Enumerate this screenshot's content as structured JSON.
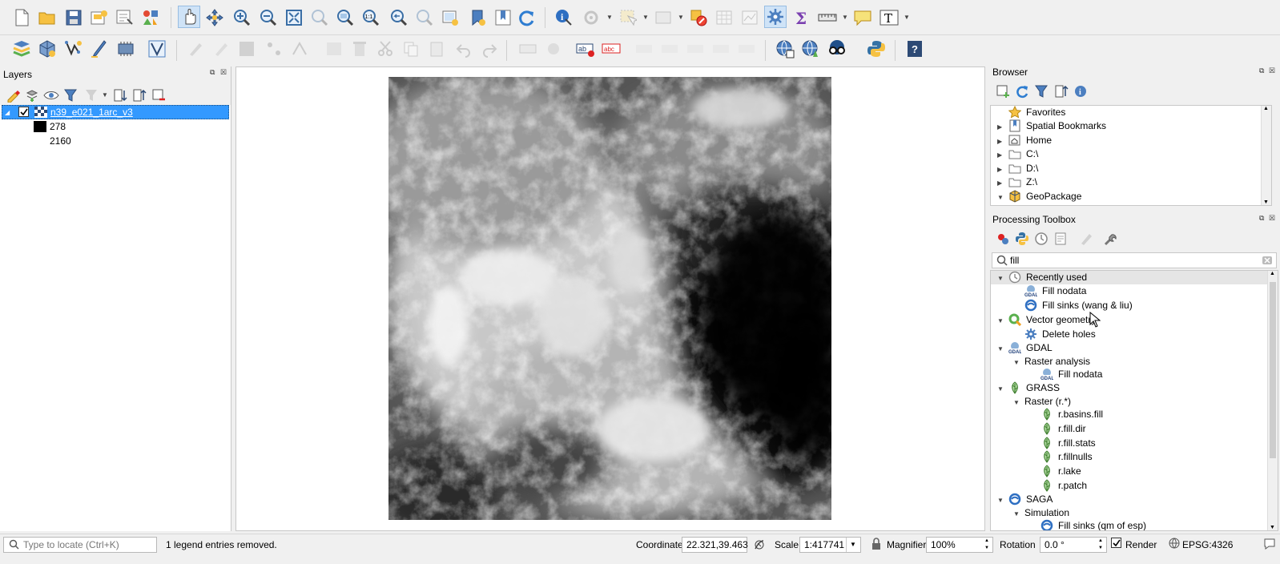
{
  "layers_panel": {
    "title": "Layers",
    "layer": {
      "name": "n39_e021_1arc_v3",
      "checked": true
    },
    "legend": [
      {
        "label": "278",
        "swatch_color": "#000000"
      },
      {
        "label": "2160",
        "swatch_color": "#ffffff"
      }
    ]
  },
  "browser_panel": {
    "title": "Browser",
    "items": [
      {
        "label": "Favorites",
        "icon": "star-icon",
        "expand": "none"
      },
      {
        "label": "Spatial Bookmarks",
        "icon": "bookmark-icon",
        "expand": "collapsed"
      },
      {
        "label": "Home",
        "icon": "home-folder-icon",
        "expand": "collapsed"
      },
      {
        "label": "C:\\",
        "icon": "folder-icon",
        "expand": "collapsed"
      },
      {
        "label": "D:\\",
        "icon": "folder-icon",
        "expand": "collapsed"
      },
      {
        "label": "Z:\\",
        "icon": "folder-icon",
        "expand": "collapsed"
      },
      {
        "label": "GeoPackage",
        "icon": "geopackage-icon",
        "expand": "expanded"
      }
    ]
  },
  "processing_toolbox": {
    "title": "Processing Toolbox",
    "search_value": "fill",
    "tree": [
      {
        "label": "Recently used",
        "icon": "clock-icon",
        "level": 0,
        "expand": "expanded"
      },
      {
        "label": "Fill nodata",
        "icon": "gdal-icon",
        "level": 2
      },
      {
        "label": "Fill sinks (wang & liu)",
        "icon": "saga-icon",
        "level": 2
      },
      {
        "label": "Vector geometry",
        "icon": "qgis-icon",
        "level": 0,
        "expand": "expanded"
      },
      {
        "label": "Delete holes",
        "icon": "gear-icon",
        "level": 2
      },
      {
        "label": "GDAL",
        "icon": "gdal-icon",
        "level": 0,
        "expand": "expanded"
      },
      {
        "label": "Raster analysis",
        "icon": "",
        "level": 1,
        "expand": "expanded"
      },
      {
        "label": "Fill nodata",
        "icon": "gdal-icon",
        "level": 3
      },
      {
        "label": "GRASS",
        "icon": "grass-icon",
        "level": 0,
        "expand": "expanded"
      },
      {
        "label": "Raster (r.*)",
        "icon": "",
        "level": 1,
        "expand": "expanded"
      },
      {
        "label": "r.basins.fill",
        "icon": "grass-icon",
        "level": 3
      },
      {
        "label": "r.fill.dir",
        "icon": "grass-icon",
        "level": 3
      },
      {
        "label": "r.fill.stats",
        "icon": "grass-icon",
        "level": 3
      },
      {
        "label": "r.fillnulls",
        "icon": "grass-icon",
        "level": 3
      },
      {
        "label": "r.lake",
        "icon": "grass-icon",
        "level": 3
      },
      {
        "label": "r.patch",
        "icon": "grass-icon",
        "level": 3
      },
      {
        "label": "SAGA",
        "icon": "saga-icon",
        "level": 0,
        "expand": "expanded"
      },
      {
        "label": "Simulation",
        "icon": "",
        "level": 1,
        "expand": "expanded"
      },
      {
        "label": "Fill sinks (qm of esp)",
        "icon": "saga-icon",
        "level": 3
      }
    ]
  },
  "statusbar": {
    "locate_placeholder": "Type to locate (Ctrl+K)",
    "message": "1 legend entries removed.",
    "coordinate_label": "Coordinate",
    "coordinate_value": "22.321,39.463",
    "scale_label": "Scale",
    "scale_value": "1:417741",
    "magnifier_label": "Magnifier",
    "magnifier_value": "100%",
    "rotation_label": "Rotation",
    "rotation_value": "0.0 °",
    "render_label": "Render",
    "render_checked": true,
    "crs_label": "EPSG:4326"
  },
  "colors": {
    "selection": "#3399ff",
    "accent_green": "#27a33a",
    "panel_bg": "#f0f0f0"
  }
}
